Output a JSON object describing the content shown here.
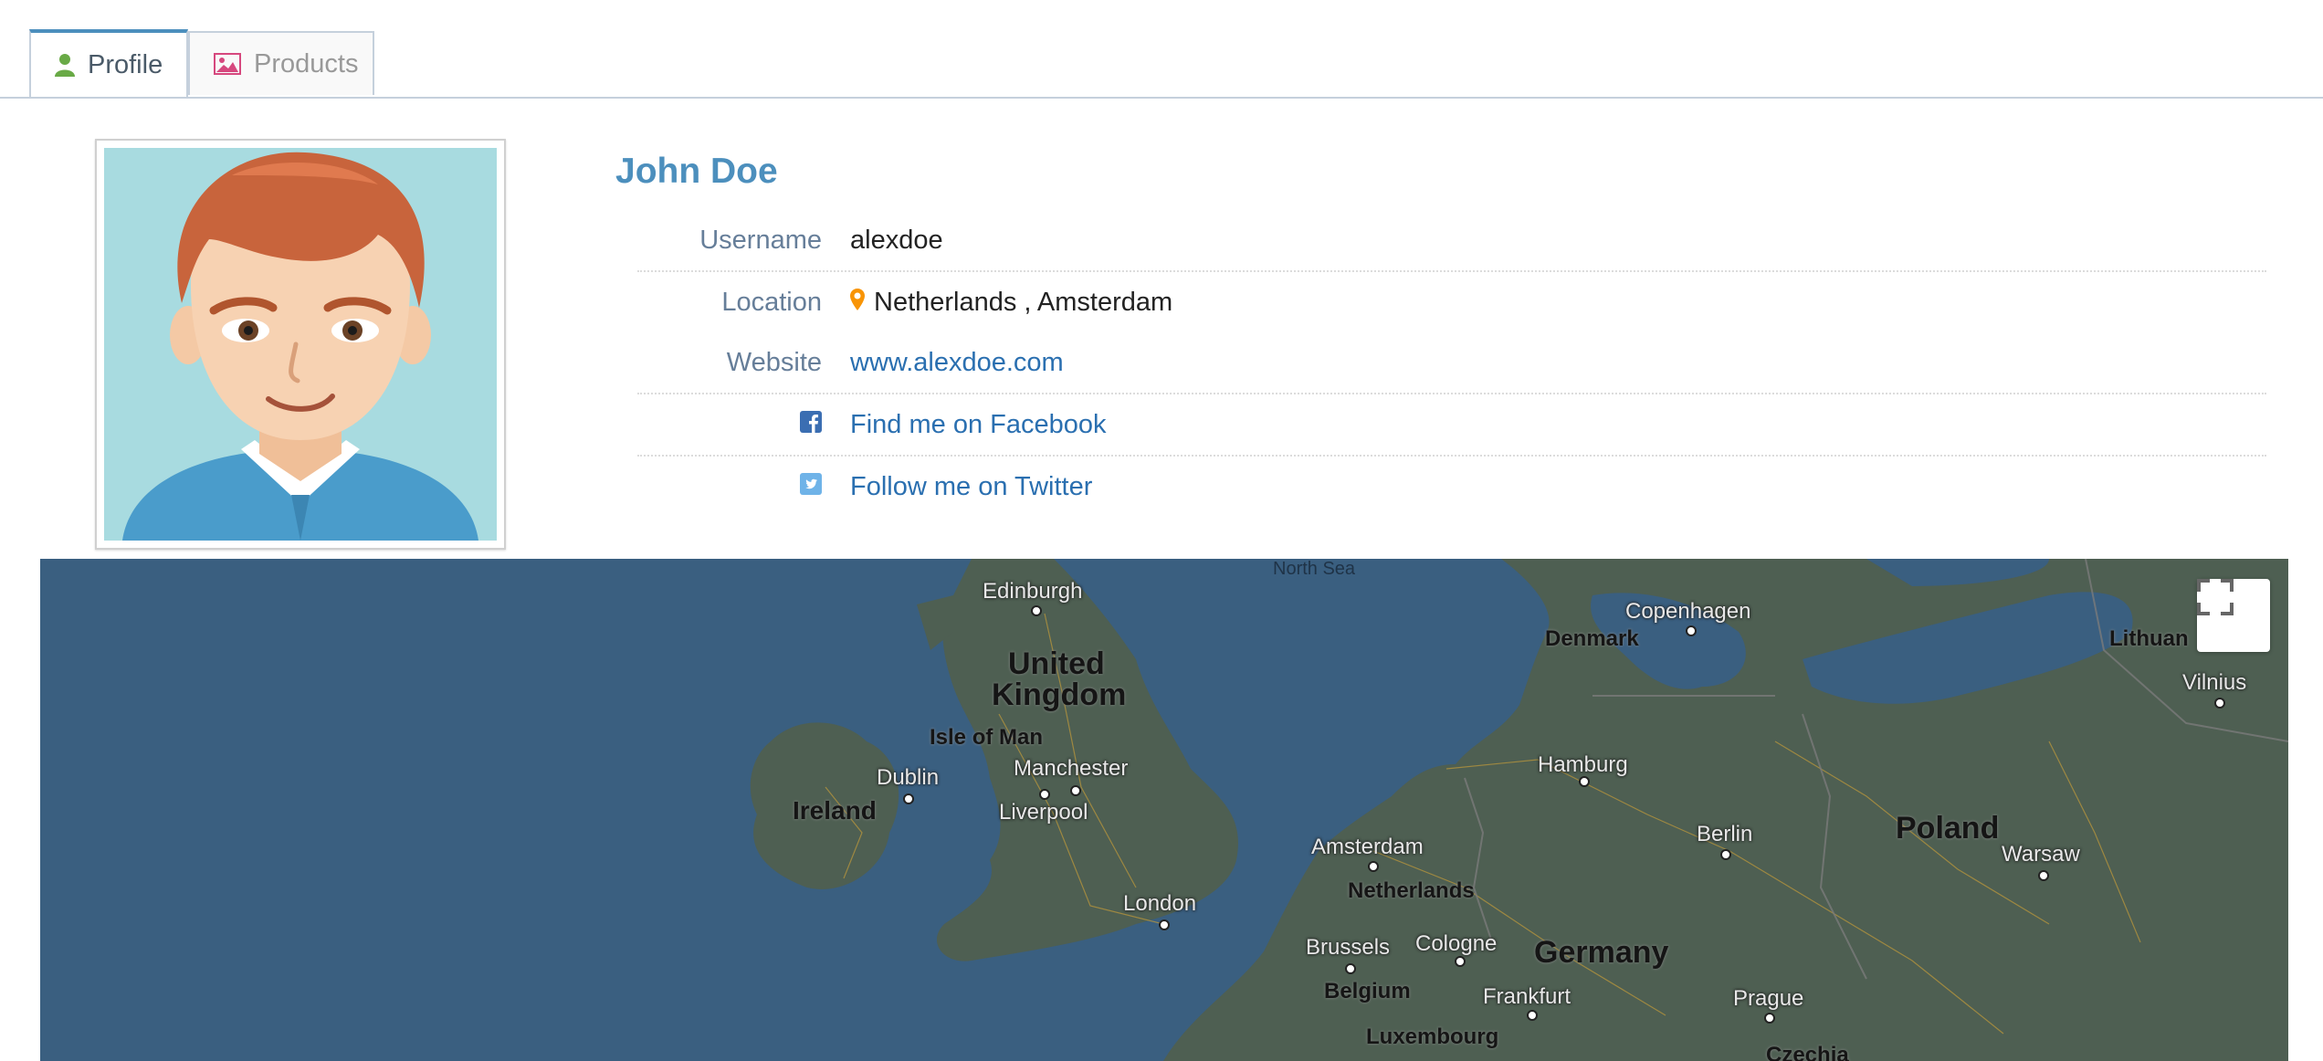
{
  "tabs": [
    {
      "label": "Profile",
      "icon": "user-icon",
      "active": true
    },
    {
      "label": "Products",
      "icon": "image-icon",
      "active": false
    }
  ],
  "profile": {
    "name": "John Doe",
    "fields": {
      "username_label": "Username",
      "username": "alexdoe",
      "location_label": "Location",
      "location_country": "Netherlands",
      "location_city": ", Amsterdam",
      "website_label": "Website",
      "website": "www.alexdoe.com",
      "facebook": "Find me on Facebook",
      "twitter": "Follow me on Twitter"
    }
  },
  "colors": {
    "accent": "#4c8fbd",
    "link": "#2a6fb0",
    "map_water": "#3a5f80",
    "map_land": "#4e5f52"
  },
  "map": {
    "labels": {
      "north_sea": "North Sea",
      "edinburgh": "Edinburgh",
      "copenhagen": "Copenhagen",
      "denmark": "Denmark",
      "lithuania": "Lithuan",
      "vilnius": "Vilnius",
      "united": "United",
      "kingdom": "Kingdom",
      "isle_of_man": "Isle of Man",
      "dublin": "Dublin",
      "ireland": "Ireland",
      "manchester": "Manchester",
      "liverpool": "Liverpool",
      "hamburg": "Hamburg",
      "berlin": "Berlin",
      "poland": "Poland",
      "warsaw": "Warsaw",
      "amsterdam": "Amsterdam",
      "netherlands": "Netherlands",
      "london": "London",
      "brussels": "Brussels",
      "cologne": "Cologne",
      "germany": "Germany",
      "belgium": "Belgium",
      "frankfurt": "Frankfurt",
      "prague": "Prague",
      "luxembourg": "Luxembourg",
      "czechia": "Czechia"
    }
  }
}
